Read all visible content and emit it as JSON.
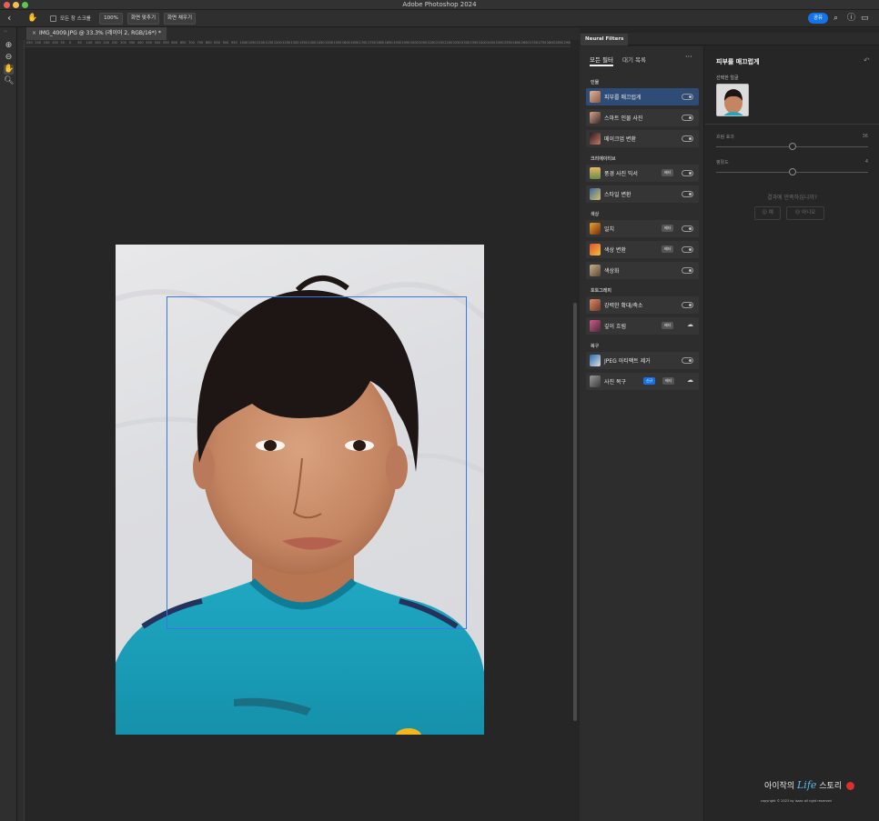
{
  "app": {
    "title": "Adobe Photoshop 2024"
  },
  "optionsbar": {
    "scroll_all_windows": "모든 창 스크롤",
    "zoom_100": "100%",
    "fit_screen": "화면 맞추기",
    "fill_screen": "화면 채우기",
    "share": "공유"
  },
  "document": {
    "tab_label": "IMG_4009.JPG @ 33.3% (레이어 2, RGB/16*) *",
    "ruler_ticks": [
      "250",
      "200",
      "150",
      "100",
      "50",
      "0",
      "50",
      "100",
      "150",
      "200",
      "250",
      "300",
      "350",
      "400",
      "450",
      "500",
      "550",
      "600",
      "650",
      "700",
      "750",
      "800",
      "850",
      "900",
      "950",
      "1000",
      "1050",
      "1100",
      "1150",
      "1200",
      "1250",
      "1300",
      "1350",
      "1400",
      "1450",
      "1500",
      "1550",
      "1600",
      "1650",
      "1700",
      "1750",
      "1800",
      "1850",
      "1900",
      "1950",
      "2000",
      "2050",
      "2100",
      "2150",
      "2200",
      "2250",
      "2300",
      "2350",
      "2400",
      "2450",
      "2500",
      "2550",
      "2600",
      "2650",
      "2700",
      "2750",
      "2800",
      "2850",
      "2900"
    ]
  },
  "neural_filters": {
    "panel_tab": "Neural Filters",
    "tab_all": "모든 필터",
    "tab_waitlist": "대기 목록",
    "more": "···",
    "categories": {
      "portrait": "인물",
      "creative": "크리에이티브",
      "color": "색상",
      "photography": "포토그래피",
      "restoration": "복구"
    },
    "filters": {
      "skin_smoothing": "피부를 매끄럽게",
      "smart_portrait": "스마트 인물 사진",
      "makeup_transfer": "메이크업 변환",
      "landscape_mixer": "풍경 사진 믹서",
      "style_transfer": "스타일 변환",
      "harmonization": "일치",
      "color_transfer": "색상 변환",
      "colorize": "색상화",
      "super_zoom": "강력한 확대/축소",
      "depth_blur": "깊이 흐림",
      "jpeg_artifacts": "JPEG 아티팩트 제거",
      "photo_restoration": "사진 복구"
    },
    "badge_beta": "베타",
    "badge_new": "신규"
  },
  "settings": {
    "title": "피부를 매끄럽게",
    "selected_face": "선택한 얼굴",
    "blur_label": "흐림 효과",
    "blur_value": "36",
    "smoothness_label": "평활도",
    "smoothness_value": "4",
    "blur_fraction": 0.5,
    "smoothness_fraction": 0.5,
    "satisfaction_q": "결과에 만족하십니까?",
    "yes": "예",
    "no": "아니오"
  },
  "watermark": {
    "line1_a": "아이작의",
    "line1_life": "Life",
    "line1_b": "스토리",
    "line2": "copyright © 2023 by isaac all right reserved"
  },
  "colors": {
    "accent": "#1473e6",
    "selected_row": "#2f4c76",
    "face_box": "#3a78e8"
  }
}
